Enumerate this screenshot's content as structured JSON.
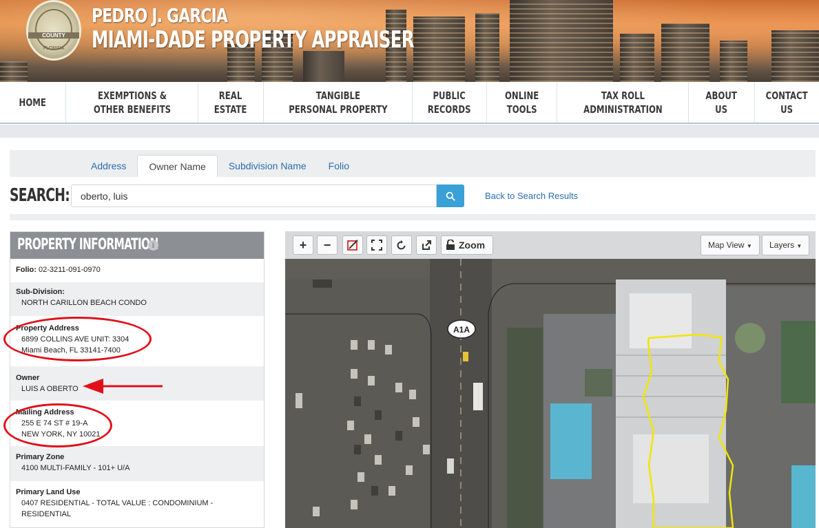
{
  "header": {
    "seal_county": "COUNTY",
    "seal_state": "FLORIDA",
    "title_line1": "PEDRO J. GARCIA",
    "title_line2": "MIAMI-DADE PROPERTY APPRAISER"
  },
  "nav": [
    {
      "label": "HOME"
    },
    {
      "label": "EXEMPTIONS &\nOTHER BENEFITS"
    },
    {
      "label": "REAL\nESTATE"
    },
    {
      "label": "TANGIBLE\nPERSONAL PROPERTY"
    },
    {
      "label": "PUBLIC\nRECORDS"
    },
    {
      "label": "ONLINE\nTOOLS"
    },
    {
      "label": "TAX ROLL\nADMINISTRATION"
    },
    {
      "label": "ABOUT\nUS"
    },
    {
      "label": "CONTACT\nUS"
    }
  ],
  "search": {
    "tabs": [
      "Address",
      "Owner Name",
      "Subdivision Name",
      "Folio"
    ],
    "active_tab": "Owner Name",
    "label": "SEARCH:",
    "value": "oberto, luis",
    "back_link": "Back to Search Results"
  },
  "property": {
    "header": "PROPERTY INFORMATION",
    "folio_label": "Folio:",
    "folio": "02-3211-091-0970",
    "subdivision_label": "Sub-Division:",
    "subdivision": "NORTH CARILLON BEACH CONDO",
    "address_label": "Property Address",
    "address_line1": "6899 COLLINS AVE   UNIT:  3304",
    "address_line2": "Miami Beach, FL  33141-7400",
    "owner_label": "Owner",
    "owner": "LUIS A OBERTO",
    "mailing_label": "Mailing Address",
    "mailing_line1": "255 E 74 ST # 19-A",
    "mailing_line2": "NEW YORK, NY 10021",
    "zone_label": "Primary Zone",
    "zone": "4100 MULTI-FAMILY - 101+ U/A",
    "land_use_label": "Primary Land Use",
    "land_use_line1": "0407 RESIDENTIAL - TOTAL VALUE : CONDOMINIUM -",
    "land_use_line2": "RESIDENTIAL"
  },
  "map": {
    "zoom_label": "Zoom",
    "map_view_label": "Map View",
    "layers_label": "Layers",
    "road_shield": "A1A",
    "parcel_color": "#f2e600",
    "annotation_color": "#e0101a"
  }
}
